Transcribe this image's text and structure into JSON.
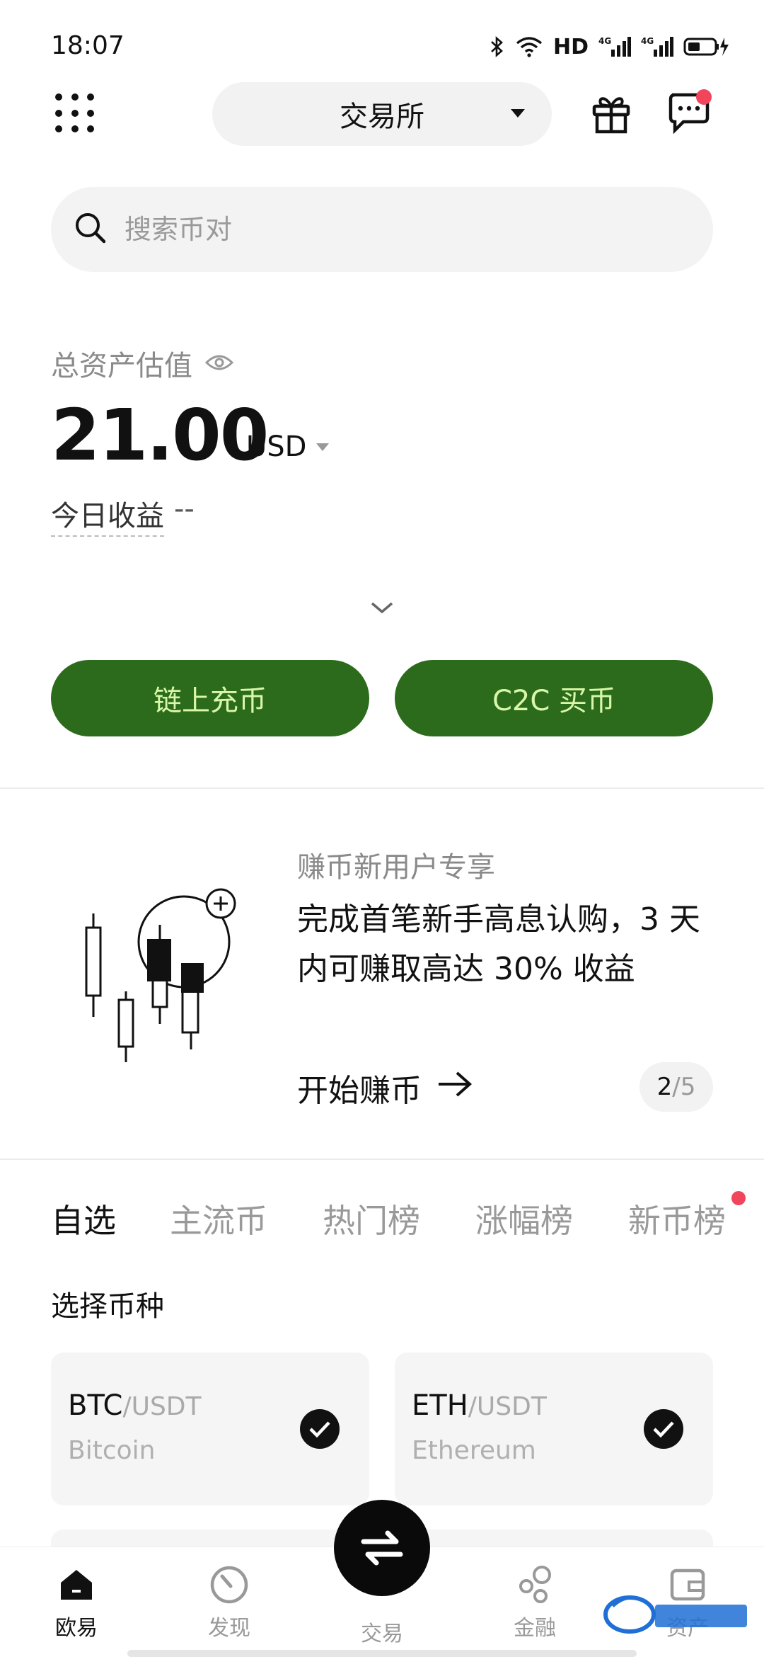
{
  "status_bar": {
    "time": "18:07",
    "network": "HD",
    "signal_1": "4G",
    "signal_2": "4G"
  },
  "header": {
    "exchange_label": "交易所",
    "menu_icon": "grid-menu-icon",
    "gift_icon": "gift-icon",
    "message_icon": "chat-icon"
  },
  "search": {
    "placeholder": "搜索币对"
  },
  "assets": {
    "label": "总资产估值",
    "value": "21.00",
    "currency": "USD",
    "today_label": "今日收益",
    "today_value": "--"
  },
  "actions": {
    "deposit": "链上充币",
    "c2c": "C2C 买币"
  },
  "promo": {
    "subtitle": "赚币新用户专享",
    "title": "完成首笔新手高息认购，3 天内可赚取高达 30% 收益",
    "cta": "开始赚币",
    "page_current": "2",
    "page_total": "/5"
  },
  "tabs": [
    {
      "label": "自选"
    },
    {
      "label": "主流币"
    },
    {
      "label": "热门榜"
    },
    {
      "label": "涨幅榜"
    },
    {
      "label": "新币榜"
    }
  ],
  "section_title": "选择币种",
  "coins": [
    {
      "base": "BTC",
      "quote": "/USDT",
      "name": "Bitcoin"
    },
    {
      "base": "ETH",
      "quote": "/USDT",
      "name": "Ethereum"
    }
  ],
  "bottom_nav": [
    {
      "label": "欧易"
    },
    {
      "label": "发现"
    },
    {
      "label": "交易"
    },
    {
      "label": "金融"
    },
    {
      "label": "资产"
    }
  ],
  "colors": {
    "accent_green": "#2c6b1c",
    "button_text": "#d9f7a8",
    "notify_red": "#f0455b"
  }
}
